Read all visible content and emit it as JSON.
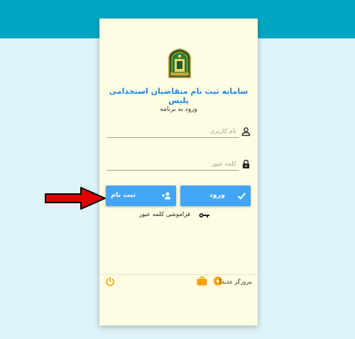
{
  "app": {
    "title": "سامانه ثبت نام متقاضیان استخدامی پلیس",
    "subtitle": "ورود به برنامه"
  },
  "form": {
    "username_placeholder": "نام کاربری",
    "password_placeholder": "کلمه عبور"
  },
  "buttons": {
    "login_label": "ورود",
    "register_label": "ثبت نام"
  },
  "links": {
    "forgot_password": "فراموشی کلمه عبور"
  },
  "footer": {
    "new_browser": "مرورگر جدید؟"
  },
  "colors": {
    "header_band": "#00a7c2",
    "background": "#def3f8",
    "card": "#fefde3",
    "accent": "#42a5f5",
    "title": "#1e88e5",
    "footer_icons": "#f5a000",
    "annotation_arrow": "#e00000"
  },
  "icons": [
    "police-emblem",
    "user-icon",
    "lock-icon",
    "check-icon",
    "add-user-icon",
    "key-icon",
    "power-icon",
    "gear-icon",
    "briefcase-icon"
  ]
}
